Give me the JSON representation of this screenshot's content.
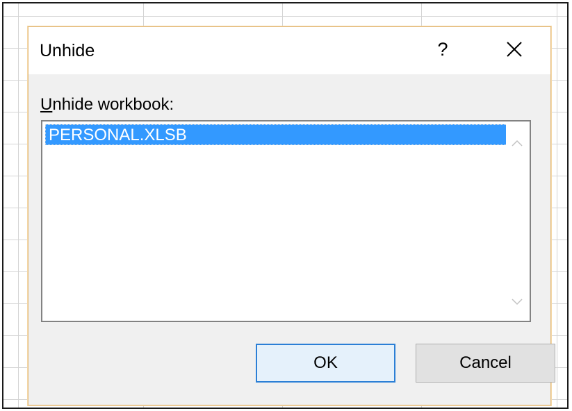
{
  "dialog": {
    "title": "Unhide",
    "help_label": "?",
    "list_label": "Unhide workbook:",
    "list_items": [
      "PERSONAL.XLSB"
    ],
    "ok_label": "OK",
    "cancel_label": "Cancel"
  },
  "icons": {
    "close": "close-icon",
    "scroll_up": "chevron-up-icon",
    "scroll_down": "chevron-down-icon"
  },
  "colors": {
    "selection": "#3399ff",
    "dialog_border": "#e2b97a",
    "default_button_border": "#2b7fd6"
  }
}
